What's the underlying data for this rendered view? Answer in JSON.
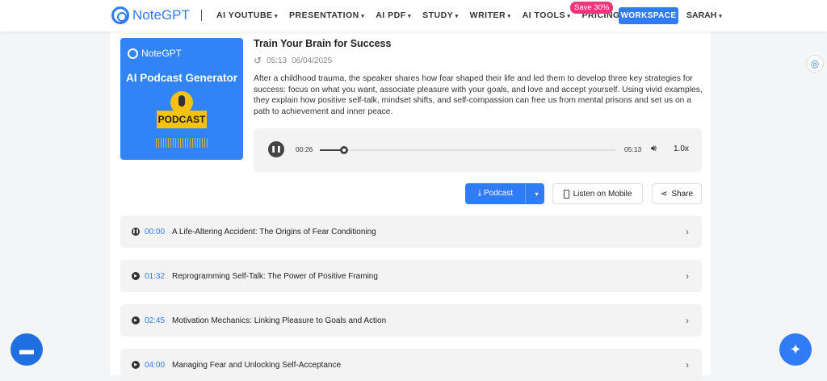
{
  "header": {
    "brand": "NoteGPT",
    "nav": [
      "AI YOUTUBE",
      "PRESENTATION",
      "AI PDF",
      "STUDY",
      "WRITER",
      "AI TOOLS"
    ],
    "pricing": "PRICING",
    "save_badge": "Save 30%",
    "workspace": "WORKSPACE",
    "user": "SARAH"
  },
  "cover": {
    "brand": "NoteGPT",
    "title": "AI Podcast Generator",
    "badge": "PODCAST"
  },
  "podcast": {
    "title": "Train Your Brain for Success",
    "duration": "05:13",
    "date": "06/04/2025",
    "description": "After a childhood trauma, the speaker shares how fear shaped their life and led them to develop three key strategies for success: focus on what you want, associate pleasure with your goals, and love and accept yourself. Using vivid examples, they explain how positive self-talk, mindset shifts, and self-compassion can free us from mental prisons and set us on a path to achievement and inner peace."
  },
  "player": {
    "current": "00:26",
    "total": "05:13",
    "progress_percent": 8.3,
    "speed": "1.0x",
    "state": "playing"
  },
  "actions": {
    "download": "Podcast",
    "mobile": "Listen on Mobile",
    "share": "Share"
  },
  "chapters": [
    {
      "time": "00:00",
      "title": "A Life-Altering Accident: The Origins of Fear Conditioning"
    },
    {
      "time": "01:32",
      "title": "Reprogramming Self-Talk: The Power of Positive Framing"
    },
    {
      "time": "02:45",
      "title": "Motivation Mechanics: Linking Pleasure to Goals and Action"
    },
    {
      "time": "04:00",
      "title": "Managing Fear and Unlocking Self-Acceptance"
    }
  ],
  "colors": {
    "accent": "#2f7cf6",
    "badge": "#f2357a",
    "podcast_yellow": "#f6c20f"
  }
}
